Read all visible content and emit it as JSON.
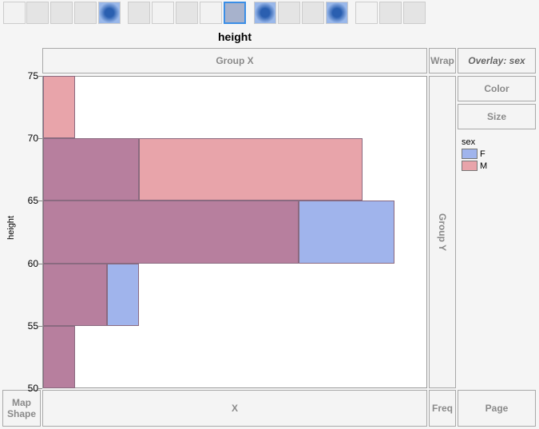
{
  "toolbar": {
    "icons": [
      "points",
      "smoother",
      "line-of-fit",
      "ellipse",
      "contour",
      "line",
      "bar",
      "area",
      "box-plot",
      "histogram",
      "heatmap",
      "pie",
      "treemap",
      "mosaic",
      "caption-box",
      "formula",
      "map-shapes"
    ],
    "selected": "histogram"
  },
  "title": "height",
  "zones": {
    "group_x": "Group X",
    "wrap": "Wrap",
    "overlay": "Overlay: sex",
    "color": "Color",
    "size": "Size",
    "group_y": "Group Y",
    "map_shape": "Map Shape",
    "x": "X",
    "freq": "Freq",
    "page": "Page"
  },
  "y_axis": {
    "label": "height",
    "ticks": [
      "75",
      "70",
      "65",
      "60",
      "55",
      "50"
    ]
  },
  "legend": {
    "title": "sex",
    "items": [
      {
        "label": "F",
        "color": "#a0b4ec"
      },
      {
        "label": "M",
        "color": "#e8a4aa"
      }
    ]
  },
  "chart_data": {
    "type": "bar",
    "orientation": "horizontal",
    "bins": [
      [
        50,
        55
      ],
      [
        55,
        60
      ],
      [
        60,
        65
      ],
      [
        65,
        70
      ],
      [
        70,
        75
      ]
    ],
    "series": [
      {
        "name": "F",
        "values": [
          1,
          3,
          11,
          3,
          0
        ],
        "color": "#a0b4ec"
      },
      {
        "name": "M",
        "values": [
          1,
          2,
          8,
          10,
          1
        ],
        "color": "#e8a4aa"
      }
    ],
    "overlap_color": "#b77f9e",
    "ylabel": "height",
    "ylim": [
      50,
      75
    ]
  }
}
